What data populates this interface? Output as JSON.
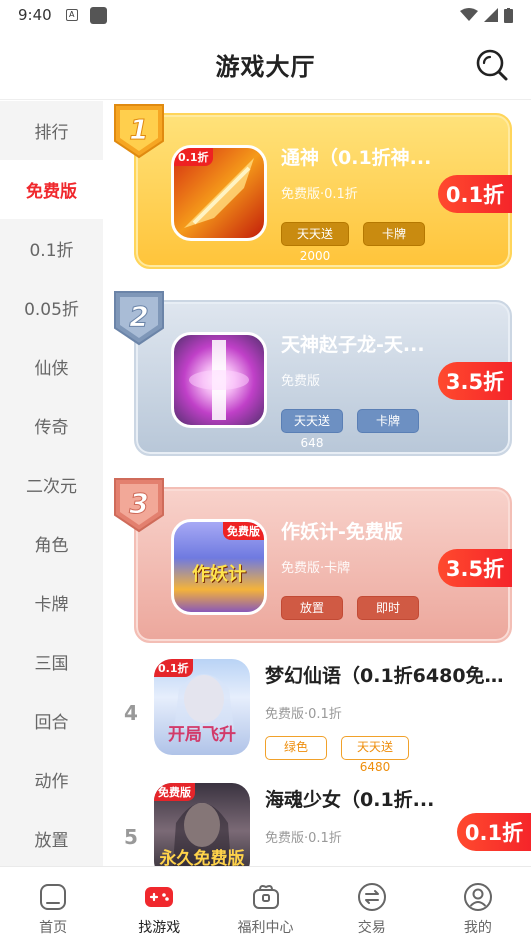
{
  "status_bar": {
    "time": "9:40"
  },
  "header": {
    "title": "游戏大厅"
  },
  "sidebar": {
    "items": [
      {
        "label": "排行"
      },
      {
        "label": "免费版"
      },
      {
        "label": "0.1折"
      },
      {
        "label": "0.05折"
      },
      {
        "label": "仙侠"
      },
      {
        "label": "传奇"
      },
      {
        "label": "二次元"
      },
      {
        "label": "角色"
      },
      {
        "label": "卡牌"
      },
      {
        "label": "三国"
      },
      {
        "label": "回合"
      },
      {
        "label": "动作"
      },
      {
        "label": "放置"
      }
    ],
    "active_index": 1
  },
  "top_games": [
    {
      "rank": "1",
      "name": "通神（0.1折神...",
      "sub": "免费版·0.1折",
      "tags": [
        "天天送2000",
        "卡牌"
      ],
      "discount": "0.1折",
      "icon_tag": "0.1折"
    },
    {
      "rank": "2",
      "name": "天神赵子龙-天...",
      "sub": "免费版",
      "tags": [
        "天天送648",
        "卡牌"
      ],
      "discount": "3.5折"
    },
    {
      "rank": "3",
      "name": "作妖计-免费版",
      "sub": "免费版·卡牌",
      "tags": [
        "放置",
        "即时"
      ],
      "discount": "3.5折",
      "icon_tag": "免费版",
      "icon_text": "作妖计"
    }
  ],
  "games": [
    {
      "rank": "4",
      "name": "梦幻仙语（0.1折6480免...",
      "sub": "免费版·0.1折",
      "tags": [
        "绿色",
        "天天送6480"
      ],
      "icon_tag": "0.1折",
      "icon_text": "开局飞升"
    },
    {
      "rank": "5",
      "name": "海魂少女（0.1折...",
      "sub": "免费版·0.1折",
      "tags": [],
      "discount": "0.1折",
      "icon_tag": "免费版",
      "icon_text": "永久免费版"
    }
  ],
  "bottom_nav": [
    {
      "label": "首页"
    },
    {
      "label": "找游戏"
    },
    {
      "label": "福利中心"
    },
    {
      "label": "交易"
    },
    {
      "label": "我的"
    }
  ],
  "colors": {
    "accent": "#f0282d",
    "discount_red": "#f5252a",
    "gold": "#ffc43a"
  }
}
